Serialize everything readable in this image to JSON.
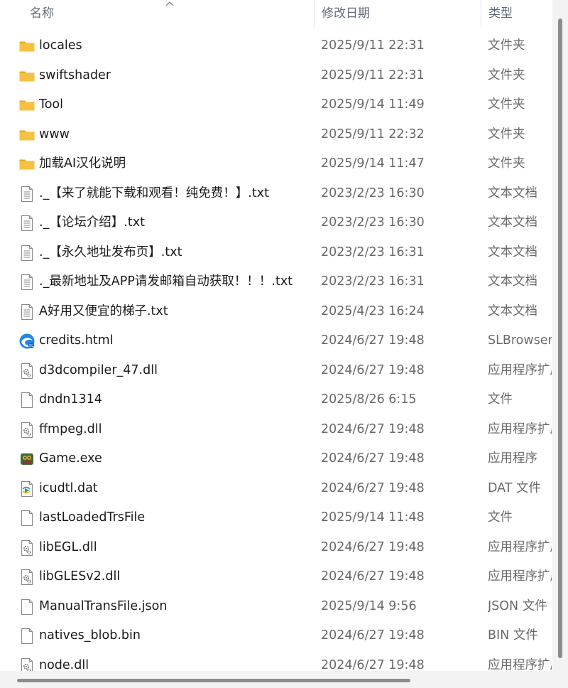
{
  "header": {
    "name_label": "名称",
    "date_label": "修改日期",
    "type_label": "类型"
  },
  "rows": [
    {
      "name": "locales",
      "date": "2025/9/11 22:31",
      "type": "文件夹",
      "icon": "folder-icon"
    },
    {
      "name": "swiftshader",
      "date": "2025/9/11 22:31",
      "type": "文件夹",
      "icon": "folder-icon"
    },
    {
      "name": "Tool",
      "date": "2025/9/14 11:49",
      "type": "文件夹",
      "icon": "folder-icon"
    },
    {
      "name": "www",
      "date": "2025/9/11 22:32",
      "type": "文件夹",
      "icon": "folder-icon"
    },
    {
      "name": "加载AI汉化说明",
      "date": "2025/9/14 11:47",
      "type": "文件夹",
      "icon": "folder-icon"
    },
    {
      "name": "._【来了就能下载和观看！纯免费！】.txt",
      "date": "2023/2/23 16:30",
      "type": "文本文档",
      "icon": "text-file-icon"
    },
    {
      "name": "._【论坛介绍】.txt",
      "date": "2023/2/23 16:30",
      "type": "文本文档",
      "icon": "text-file-icon"
    },
    {
      "name": "._【永久地址发布页】.txt",
      "date": "2023/2/23 16:31",
      "type": "文本文档",
      "icon": "text-file-icon"
    },
    {
      "name": "._最新地址及APP请发邮箱自动获取！！！.txt",
      "date": "2023/2/23 16:31",
      "type": "文本文档",
      "icon": "text-file-icon"
    },
    {
      "name": "A好用又便宜的梯子.txt",
      "date": "2025/4/23 16:24",
      "type": "文本文档",
      "icon": "text-file-icon"
    },
    {
      "name": "credits.html",
      "date": "2024/6/27 19:48",
      "type": "SLBrowser",
      "icon": "browser-icon"
    },
    {
      "name": "d3dcompiler_47.dll",
      "date": "2024/6/27 19:48",
      "type": "应用程序扩展",
      "icon": "dll-file-icon"
    },
    {
      "name": "dndn1314",
      "date": "2025/8/26 6:15",
      "type": "文件",
      "icon": "blank-file-icon"
    },
    {
      "name": "ffmpeg.dll",
      "date": "2024/6/27 19:48",
      "type": "应用程序扩展",
      "icon": "dll-file-icon"
    },
    {
      "name": "Game.exe",
      "date": "2024/6/27 19:48",
      "type": "应用程序",
      "icon": "game-exe-icon"
    },
    {
      "name": "icudtl.dat",
      "date": "2024/6/27 19:48",
      "type": "DAT 文件",
      "icon": "media-file-icon"
    },
    {
      "name": "lastLoadedTrsFile",
      "date": "2025/9/14 11:48",
      "type": "文件",
      "icon": "blank-file-icon"
    },
    {
      "name": "libEGL.dll",
      "date": "2024/6/27 19:48",
      "type": "应用程序扩展",
      "icon": "dll-file-icon"
    },
    {
      "name": "libGLESv2.dll",
      "date": "2024/6/27 19:48",
      "type": "应用程序扩展",
      "icon": "dll-file-icon"
    },
    {
      "name": "ManualTransFile.json",
      "date": "2025/9/14 9:56",
      "type": "JSON 文件",
      "icon": "blank-file-icon"
    },
    {
      "name": "natives_blob.bin",
      "date": "2024/6/27 19:48",
      "type": "BIN 文件",
      "icon": "blank-file-icon"
    },
    {
      "name": "node.dll",
      "date": "2024/6/27 19:48",
      "type": "应用程序扩展",
      "icon": "dll-file-icon"
    }
  ],
  "colors": {
    "folder": "#f6c142",
    "folder_dark": "#e8a92b",
    "header_text": "#5f6b7a",
    "date_text": "#6a6a6a"
  }
}
